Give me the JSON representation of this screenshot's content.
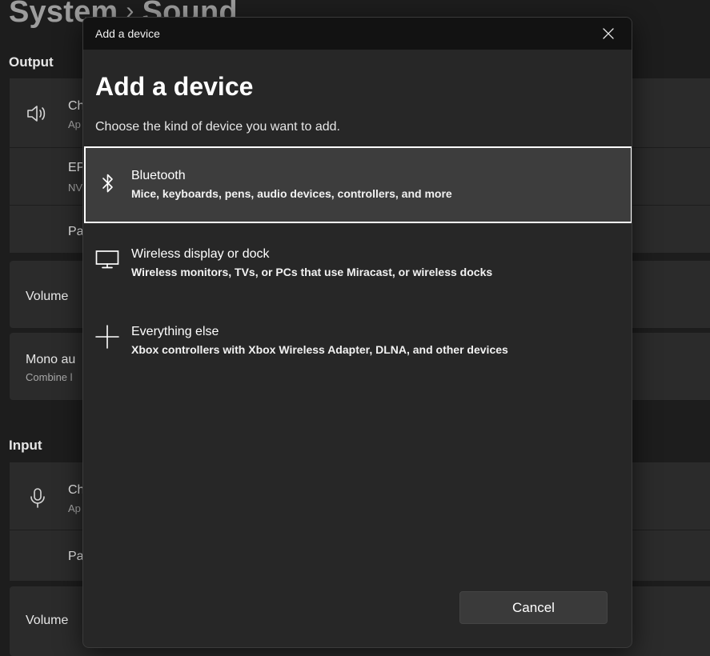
{
  "background": {
    "breadcrumb": {
      "parent": "System",
      "separator": "›",
      "current": "Sound"
    },
    "output_section": {
      "label": "Output",
      "rows": [
        {
          "title": "Ch",
          "subtitle": "Ap"
        },
        {
          "title": "EP",
          "subtitle": "NV"
        },
        {
          "title": "Pa",
          "subtitle": ""
        }
      ],
      "volume_label": "Volume",
      "mono_audio": {
        "title": "Mono au",
        "subtitle": "Combine l"
      }
    },
    "input_section": {
      "label": "Input",
      "rows": [
        {
          "title": "Ch",
          "subtitle": "Ap"
        },
        {
          "title": "Pa",
          "subtitle": ""
        }
      ],
      "volume_label": "Volume"
    }
  },
  "dialog": {
    "window_title": "Add a device",
    "heading": "Add a device",
    "subheading": "Choose the kind of device you want to add.",
    "options": [
      {
        "icon": "bluetooth-icon",
        "title": "Bluetooth",
        "description": "Mice, keyboards, pens, audio devices, controllers, and more",
        "selected": true
      },
      {
        "icon": "monitor-icon",
        "title": "Wireless display or dock",
        "description": "Wireless monitors, TVs, or PCs that use Miracast, or wireless docks",
        "selected": false
      },
      {
        "icon": "plus-icon",
        "title": "Everything else",
        "description": "Xbox controllers with Xbox Wireless Adapter, DLNA, and other devices",
        "selected": false
      }
    ],
    "cancel_label": "Cancel"
  },
  "colors": {
    "page_background": "#1d1d1d",
    "card_background": "#2b2b2b",
    "dialog_background": "#272727",
    "titlebar_background": "#121212",
    "selected_option_background": "#3d3d3d",
    "selected_option_border": "#ffffff"
  }
}
